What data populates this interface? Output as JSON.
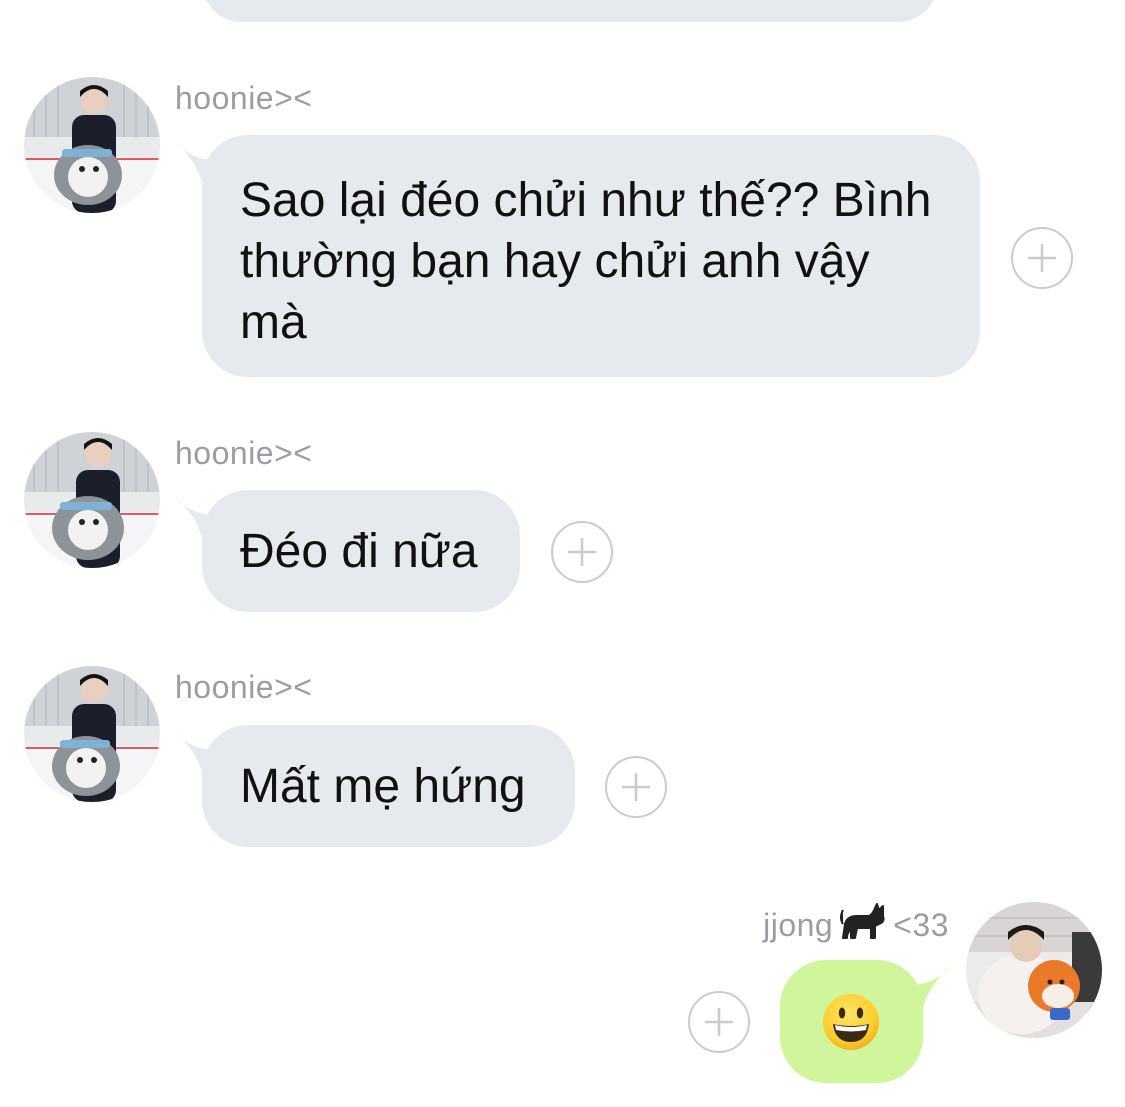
{
  "messages": [
    {
      "sender": "hoonie><",
      "text": "Sao lại đéo chửi như thế?? Bình thường bạn hay chửi anh vậy mà",
      "direction": "incoming"
    },
    {
      "sender": "hoonie><",
      "text": "Đéo đi nữa",
      "direction": "incoming"
    },
    {
      "sender": "hoonie><",
      "text": "Mất mẹ hứng",
      "direction": "incoming"
    },
    {
      "sender_prefix": "jjong",
      "sender_emoji": "black-cat",
      "sender_suffix": "<33",
      "content": "grinning-face-emoji",
      "direction": "outgoing"
    }
  ],
  "colors": {
    "incoming_bubble": "#e6e9ed",
    "outgoing_bubble": "#d1f59a",
    "sender_name": "#9a9da2",
    "add_button_border": "#c9cbcf",
    "background": "#ffffff"
  },
  "icons": {
    "add": "plus-circle-icon",
    "avatar_incoming": "avatar-penguin-photo",
    "avatar_outgoing": "avatar-orange-plush-photo"
  }
}
